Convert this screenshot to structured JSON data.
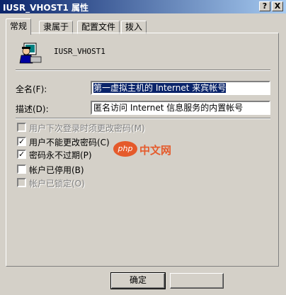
{
  "window": {
    "title": "IUSR_VHOST1 属性",
    "help_label": "?",
    "close_label": "X"
  },
  "tabs": [
    {
      "label": "常规",
      "active": true
    },
    {
      "label": "隶属于",
      "active": false
    },
    {
      "label": "配置文件",
      "active": false
    },
    {
      "label": "拨入",
      "active": false
    }
  ],
  "user": {
    "name": "IUSR_VHOST1"
  },
  "fields": {
    "full_name": {
      "label": "全名(F):",
      "value": "第一虚拟主机的 Internet 来宾帐号"
    },
    "description": {
      "label": "描述(D):",
      "value": "匿名访问 Internet 信息服务的内置帐号"
    }
  },
  "checkboxes": [
    {
      "label": "用户下次登录时须更改密码(M)",
      "checked": false,
      "enabled": false
    },
    {
      "label": "用户不能更改密码(C)",
      "checked": true,
      "enabled": true
    },
    {
      "label": "密码永不过期(P)",
      "checked": true,
      "enabled": true
    },
    {
      "label": "帐户已停用(B)",
      "checked": false,
      "enabled": true
    },
    {
      "label": "帐户已锁定(O)",
      "checked": false,
      "enabled": false
    }
  ],
  "watermark": {
    "logo": "php",
    "text": "中文网"
  },
  "buttons": {
    "ok": "确定"
  },
  "check_mark": "✓"
}
